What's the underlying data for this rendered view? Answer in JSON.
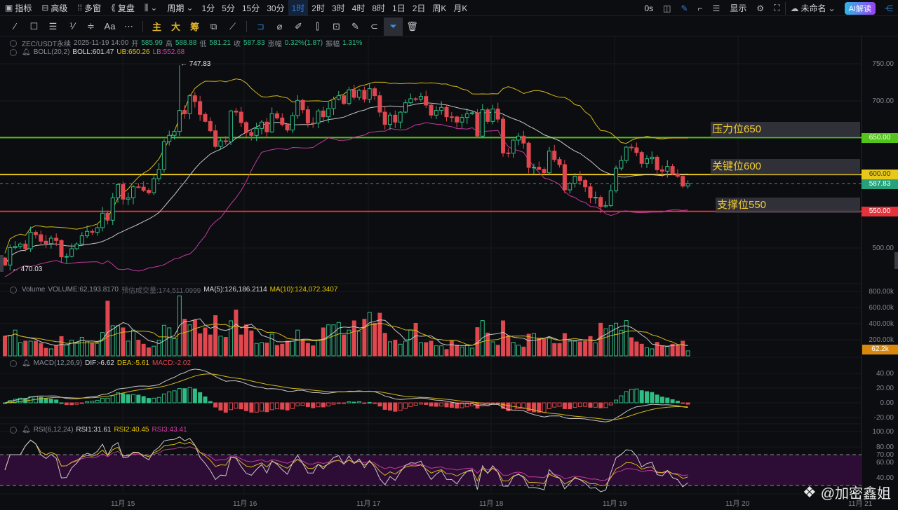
{
  "toolbar": {
    "left": [
      {
        "icon": "chart-icon",
        "label": "指标"
      },
      {
        "icon": "layout-icon",
        "label": "高级"
      },
      {
        "icon": "grid-icon",
        "label": "多窗"
      },
      {
        "icon": "replay-icon",
        "label": "复盘"
      }
    ],
    "period_label": "周期",
    "periods": [
      "1分",
      "5分",
      "15分",
      "30分",
      "1时",
      "2时",
      "3时",
      "4时",
      "8时",
      "1日",
      "2日",
      "周K",
      "月K"
    ],
    "active_period": "1时",
    "countdown": "0s",
    "display_label": "显示",
    "layout_name": "未命名",
    "ai_label": "AI解读"
  },
  "drawing_tools": {
    "main_label": "主",
    "big_label": "大",
    "chip_label": "筹",
    "text_label": "Aa"
  },
  "info": {
    "symbol": "ZEC/USDT永续",
    "datetime": "2025-11-19 14:00",
    "open_label": "开",
    "open": "585.99",
    "high_label": "高",
    "high": "588.88",
    "low_label": "低",
    "low": "581.21",
    "close_label": "收",
    "close": "587.83",
    "change_label": "涨幅",
    "change": "0.32%(1.87)",
    "amp_label": "振幅",
    "amp": "1.31%",
    "boll_name": "BOLL(20,2)",
    "boll": "BOLL:601.47",
    "ub": "UB:650.26",
    "lb": "LB:552.68"
  },
  "volume_info": {
    "name": "Volume",
    "vol": "VOLUME:62,193.8170",
    "est_label": "预估成交量:174,511.0999",
    "ma5": "MA(5):126,186.2114",
    "ma10": "MA(10):124,072.3407"
  },
  "macd_info": {
    "name": "MACD(12,26,9)",
    "dif": "DIF:-6.62",
    "dea": "DEA:-5.61",
    "macd": "MACD:-2.02"
  },
  "rsi_info": {
    "name": "RSI(6,12,24)",
    "rsi1": "RSI1:31.61",
    "rsi2": "RSI2:40.45",
    "rsi3": "RSI3:43.41"
  },
  "levels": [
    {
      "label": "压力位650",
      "price": 650,
      "badge": "650.00",
      "color": "#52c41a"
    },
    {
      "label": "关键位600",
      "price": 600,
      "badge": "600.00",
      "color": "#e8c81a"
    },
    {
      "label": "支撑位550",
      "price": 550,
      "badge": "550.00",
      "color": "#e5323b"
    }
  ],
  "last_price": {
    "value": 587.83,
    "badge": "587.83",
    "color": "#26a17b"
  },
  "high_mark": {
    "value": 747.83,
    "label": "747.83",
    "index": 34
  },
  "low_mark": {
    "value": 470.03,
    "label": "470.03",
    "index": 1
  },
  "price_axis": [
    "750.00",
    "700.00",
    "500.00"
  ],
  "volume_axis": [
    "800.00k",
    "600.00k",
    "400.00k",
    "200.00k"
  ],
  "volume_badge": "62.2k",
  "macd_axis": [
    "40.00",
    "20.00",
    "0.00",
    "-20.00"
  ],
  "rsi_axis": [
    "100.00",
    "80.00",
    "70.00",
    "60.00",
    "40.00"
  ],
  "time_axis": [
    "11月 15",
    "11月 16",
    "11月 17",
    "11月 18",
    "11月 19",
    "11月 20",
    "11月 21"
  ],
  "watermark": "@加密鑫姐",
  "colors": {
    "up": "#2ebd85",
    "down": "#e0474f",
    "boll": "#c8c8c8",
    "ub": "#d4b818",
    "lb": "#c23aa0"
  },
  "chart_data": {
    "type": "candlestick",
    "interval": "1h",
    "first_open": 487,
    "close": [
      477.4,
      501,
      502.7,
      505.9,
      499.5,
      521.7,
      518.5,
      509.7,
      506.5,
      513.8,
      510.6,
      488.5,
      489,
      499.5,
      505.9,
      517,
      523,
      521.7,
      528,
      547.6,
      538.1,
      568.5,
      586.5,
      566.6,
      568.5,
      583.3,
      583,
      578.6,
      575.4,
      594.4,
      607,
      644.4,
      653,
      658.3,
      686.8,
      682.3,
      706.7,
      698.8,
      681.4,
      671.9,
      659.2,
      638,
      645.6,
      644.4,
      686,
      684.5,
      670.3,
      657,
      652.9,
      662.4,
      671,
      657.7,
      682.3,
      676.6,
      667.8,
      660.2,
      679.8,
      700.4,
      687.7,
      669.7,
      669.5,
      686.1,
      678.2,
      689.3,
      701.9,
      706.7,
      696.2,
      714.6,
      704.5,
      714,
      702,
      716.2,
      706.7,
      684.5,
      667.8,
      680.4,
      671,
      684.5,
      697.2,
      702.6,
      702,
      705.7,
      694,
      680.4,
      686.8,
      690.9,
      678.2,
      678,
      671,
      677.3,
      682.3,
      683.6,
      652,
      687.7,
      671.9,
      688.7,
      675,
      629.2,
      629,
      646.6,
      652,
      642.5,
      609.6,
      609.8,
      607,
      602.3,
      631.7,
      620.3,
      613.4,
      579.2,
      588.1,
      597.6,
      591.9,
      583.3,
      568.5,
      569.1,
      556.5,
      558,
      578,
      608.6,
      619,
      637.1,
      636.2,
      629.8,
      615,
      621.3,
      623.5,
      606.4,
      604.5,
      610.9,
      600.7,
      597.6,
      584.3,
      587.83
    ],
    "volume_k": [
      245,
      255,
      320,
      165,
      183,
      183,
      183,
      155,
      95,
      87,
      130,
      240,
      135,
      195,
      165,
      230,
      183,
      155,
      155,
      290,
      680,
      375,
      375,
      348,
      183,
      320,
      195,
      145,
      100,
      120,
      195,
      380,
      348,
      215,
      745,
      455,
      385,
      443,
      275,
      348,
      260,
      500,
      245,
      230,
      435,
      570,
      260,
      385,
      310,
      155,
      165,
      160,
      270,
      130,
      145,
      183,
      183,
      320,
      200,
      155,
      125,
      195,
      348,
      385,
      385,
      415,
      260,
      320,
      435,
      305,
      455,
      540,
      405,
      530,
      280,
      175,
      195,
      145,
      183,
      320,
      405,
      165,
      165,
      183,
      125,
      125,
      80,
      183,
      133,
      110,
      133,
      96,
      351,
      438,
      284,
      174,
      133,
      435,
      249,
      168,
      133,
      110,
      270,
      278,
      220,
      212,
      220,
      154,
      154,
      278,
      183,
      183,
      174,
      183,
      241,
      162,
      406,
      336,
      377,
      406,
      319,
      438,
      226,
      174,
      145,
      101,
      87,
      168,
      125,
      116,
      145,
      133,
      183,
      62.2
    ],
    "ylim": [
      450,
      775
    ],
    "indicators": [
      "BOLL(20,2)",
      "VOL MA(5,10)",
      "MACD(12,26,9)",
      "RSI(6,12,24)"
    ]
  }
}
